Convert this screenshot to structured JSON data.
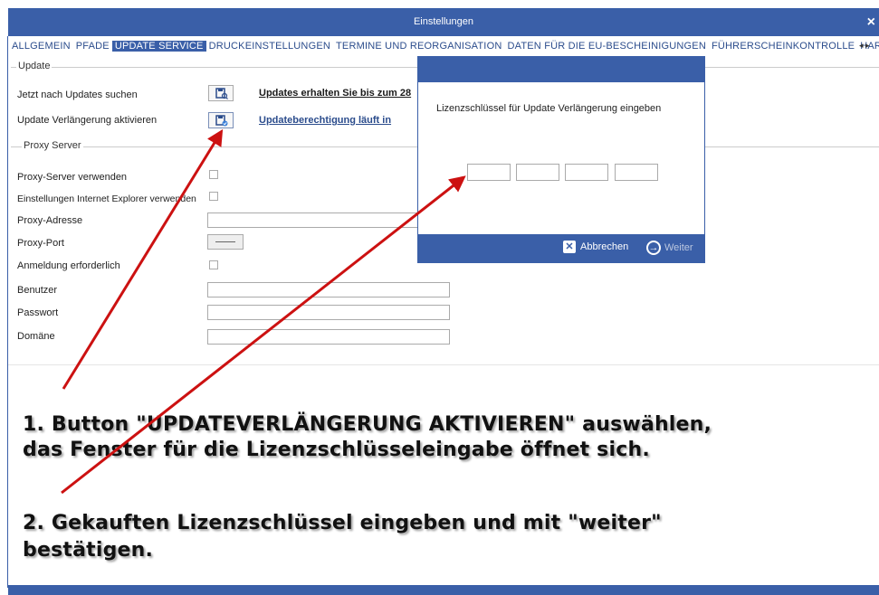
{
  "window": {
    "title": "Einstellungen",
    "close_glyph": "×"
  },
  "tabs": [
    {
      "label": "ALLGEMEIN",
      "active": false
    },
    {
      "label": "PFADE",
      "active": false
    },
    {
      "label": "UPDATE SERVICE",
      "active": true
    },
    {
      "label": "DRUCKEINSTELLUNGEN",
      "active": false
    },
    {
      "label": "TERMINE UND REORGANISATION",
      "active": false
    },
    {
      "label": "DATEN FÜR DIE EU-BESCHEINIGUNGEN",
      "active": false
    },
    {
      "label": "FÜHRERSCHEINKONTROLLE",
      "active": false
    },
    {
      "label": "HAR",
      "active": false
    }
  ],
  "tab_scroll": "◂ ▸",
  "update": {
    "group_label": "Update",
    "search_label": "Jetzt nach Updates suchen",
    "search_status": "Updates erhalten Sie bis zum 28",
    "extend_label": "Update Verlängerung aktivieren",
    "extend_status": "Updateberechtigung läuft in"
  },
  "proxy": {
    "group_label": "Proxy Server",
    "use_proxy": "Proxy-Server verwenden",
    "ie_settings": "Einstellungen Internet Explorer verwenden",
    "address": "Proxy-Adresse",
    "port": "Proxy-Port",
    "auth": "Anmeldung erforderlich",
    "user": "Benutzer",
    "password": "Passwort",
    "domain": "Domäne"
  },
  "dialog": {
    "prompt": "Lizenzschlüssel für Update Verlängerung eingeben",
    "cancel": "Abbrechen",
    "next": "Weiter"
  },
  "instructions": {
    "step1_line1": "1. Button \"UPDATEVERLÄNGERUNG AKTIVIEREN\" auswählen,",
    "step1_line2": "das Fenster für die Lizenzschlüsseleingabe öffnet sich.",
    "step2_line1": "2. Gekauften  Lizenzschlüssel eingeben und mit \"weiter\"",
    "step2_line2": "bestätigen."
  },
  "colors": {
    "accent": "#3a5fa8",
    "link_dark": "#1a1a1a",
    "link_blue": "#2b4c8c",
    "arrow": "#cc1111"
  },
  "icons": {
    "close": "close-icon",
    "search_update": "search-update-icon",
    "extend_update": "extend-update-icon"
  }
}
